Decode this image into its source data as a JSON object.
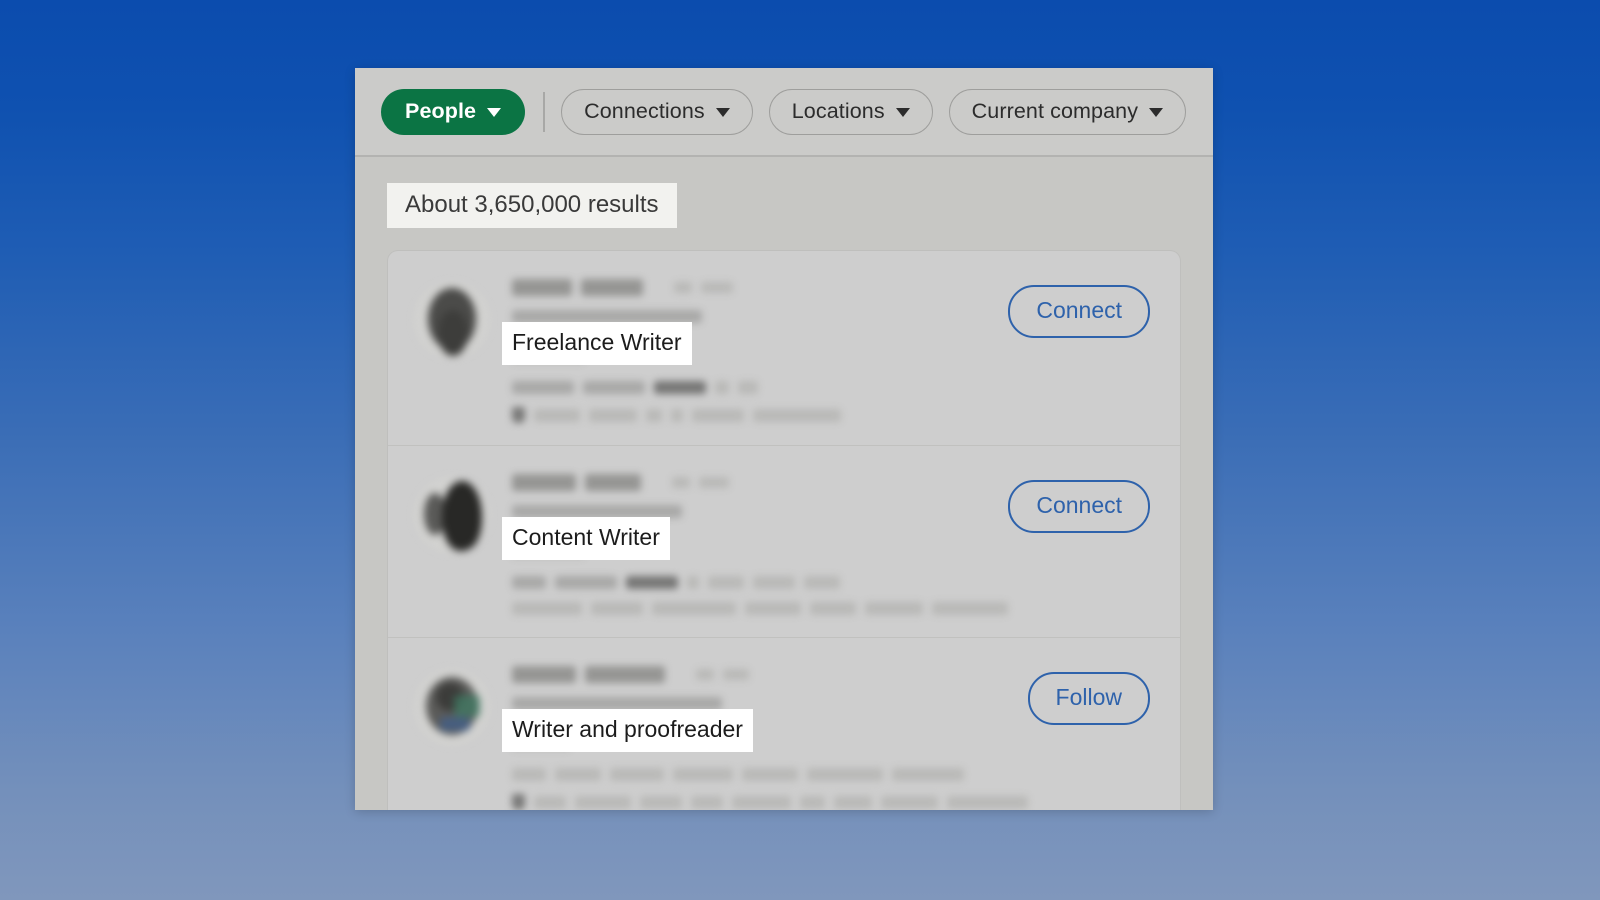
{
  "window": {
    "background_top_color": "#0b4cae",
    "background_bottom_color": "#8097bc",
    "panel_color": "#c7c7c5"
  },
  "filter_bar": {
    "primary_filter": {
      "label": "People",
      "icon": "chevron-down-icon",
      "color": "#0b7444",
      "active": true
    },
    "filters": [
      {
        "label": "Connections",
        "icon": "chevron-down-icon"
      },
      {
        "label": "Locations",
        "icon": "chevron-down-icon"
      },
      {
        "label": "Current company",
        "icon": "chevron-down-icon"
      }
    ]
  },
  "results": {
    "count_text": "About 3,650,000 results",
    "items": [
      {
        "headline": "Freelance Writer",
        "action_label": "Connect",
        "action_color": "#2e62ab",
        "avatar": "blurred-profile-photo-1"
      },
      {
        "headline": "Content Writer",
        "action_label": "Connect",
        "action_color": "#2e62ab",
        "avatar": "blurred-profile-photo-2"
      },
      {
        "headline": "Writer and proofreader",
        "action_label": "Follow",
        "action_color": "#2e62ab",
        "avatar": "blurred-profile-photo-3"
      }
    ]
  }
}
